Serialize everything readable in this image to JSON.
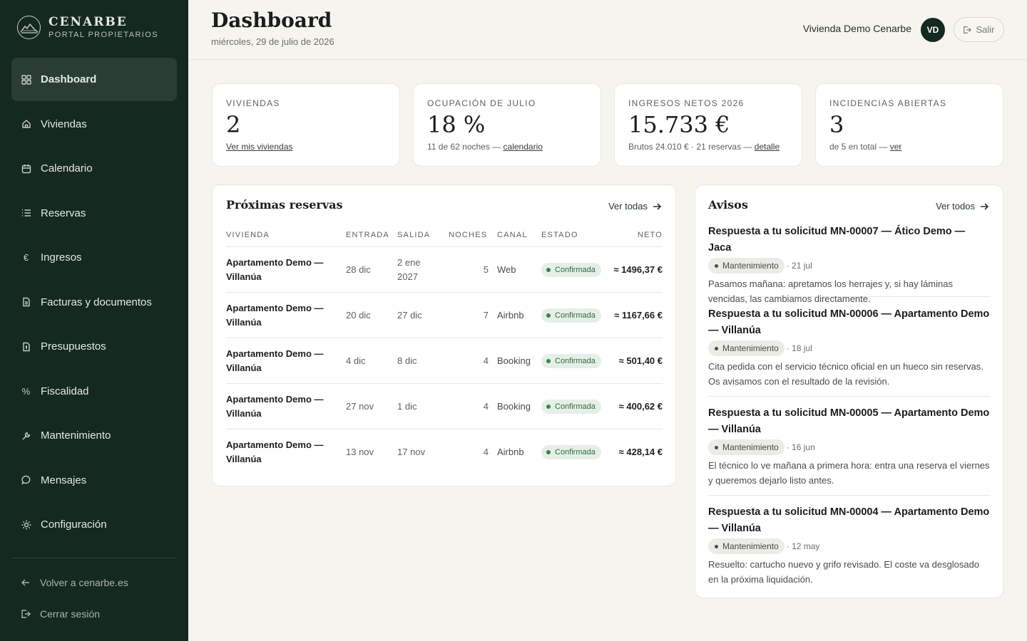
{
  "brand": {
    "name": "CENARBE",
    "subtitle": "PORTAL PROPIETARIOS"
  },
  "nav": [
    {
      "label": "Dashboard",
      "icon": "grid-icon",
      "active": true
    },
    {
      "label": "Viviendas",
      "icon": "home-icon"
    },
    {
      "label": "Calendario",
      "icon": "calendar-icon"
    },
    {
      "label": "Reservas",
      "icon": "list-icon"
    },
    {
      "label": "Ingresos",
      "icon": "euro-icon"
    },
    {
      "label": "Facturas y documentos",
      "icon": "document-icon"
    },
    {
      "label": "Presupuestos",
      "icon": "quote-document-icon"
    },
    {
      "label": "Fiscalidad",
      "icon": "percent-icon"
    },
    {
      "label": "Mantenimiento",
      "icon": "wrench-icon"
    },
    {
      "label": "Mensajes",
      "icon": "chat-icon"
    },
    {
      "label": "Configuración",
      "icon": "sun-gear-icon"
    }
  ],
  "footer": {
    "back_label": "Volver a cenarbe.es",
    "logout_label": "Cerrar sesión"
  },
  "header": {
    "title": "Dashboard",
    "date": "miércoles, 29 de julio de 2026",
    "user_name": "Vivienda Demo Cenarbe",
    "avatar_initials": "VD",
    "logout_label": "Salir"
  },
  "stats": [
    {
      "label": "VIVIENDAS",
      "value": "2",
      "sub_text": "",
      "link": "Ver mis viviendas"
    },
    {
      "label": "OCUPACIÓN DE JULIO",
      "value": "18 %",
      "sub_text": "11 de 62 noches — ",
      "link": "calendario"
    },
    {
      "label": "INGRESOS NETOS 2026",
      "value": "15.733 €",
      "sub_text": "Brutos 24.010 € · 21 reservas — ",
      "link": "detalle"
    },
    {
      "label": "INCIDENCIAS ABIERTAS",
      "value": "3",
      "sub_text": "de 5 en total — ",
      "link": "ver"
    }
  ],
  "reservations": {
    "title": "Próximas reservas",
    "link": "Ver todas",
    "columns": {
      "vivienda": "VIVIENDA",
      "entrada": "ENTRADA",
      "salida": "SALIDA",
      "noches": "NOCHES",
      "canal": "CANAL",
      "estado": "ESTADO",
      "neto": "NETO"
    },
    "rows": [
      {
        "vivienda": "Apartamento Demo — Villanúa",
        "entrada": "28 dic",
        "salida": "2 ene 2027",
        "noches": "5",
        "canal": "Web",
        "estado": "Confirmada",
        "neto": "≈ 1496,37 €"
      },
      {
        "vivienda": "Apartamento Demo — Villanúa",
        "entrada": "20 dic",
        "salida": "27 dic",
        "noches": "7",
        "canal": "Airbnb",
        "estado": "Confirmada",
        "neto": "≈ 1167,66 €"
      },
      {
        "vivienda": "Apartamento Demo — Villanúa",
        "entrada": "4 dic",
        "salida": "8 dic",
        "noches": "4",
        "canal": "Booking",
        "estado": "Confirmada",
        "neto": "≈ 501,40 €"
      },
      {
        "vivienda": "Apartamento Demo — Villanúa",
        "entrada": "27 nov",
        "salida": "1 dic",
        "noches": "4",
        "canal": "Booking",
        "estado": "Confirmada",
        "neto": "≈ 400,62 €"
      },
      {
        "vivienda": "Apartamento Demo — Villanúa",
        "entrada": "13 nov",
        "salida": "17 nov",
        "noches": "4",
        "canal": "Airbnb",
        "estado": "Confirmada",
        "neto": "≈ 428,14 €"
      }
    ]
  },
  "notices": {
    "title": "Avisos",
    "link": "Ver todos",
    "items": [
      {
        "title": "Respuesta a tu solicitud MN-00007 — Ático Demo — Jaca",
        "tag": "Mantenimiento",
        "date": "· 21 jul",
        "body": "Pasamos mañana: apretamos los herrajes y, si hay láminas vencidas, las cambiamos directamente."
      },
      {
        "title": "Respuesta a tu solicitud MN-00006 — Apartamento Demo — Villanúa",
        "tag": "Mantenimiento",
        "date": "· 18 jul",
        "body": "Cita pedida con el servicio técnico oficial en un hueco sin reservas. Os avisamos con el resultado de la revisión."
      },
      {
        "title": "Respuesta a tu solicitud MN-00005 — Apartamento Demo — Villanúa",
        "tag": "Mantenimiento",
        "date": "· 16 jun",
        "body": "El técnico lo ve mañana a primera hora: entra una reserva el viernes y queremos dejarlo listo antes."
      },
      {
        "title": "Respuesta a tu solicitud MN-00004 — Apartamento Demo — Villanúa",
        "tag": "Mantenimiento",
        "date": "· 12 may",
        "body": "Resuelto: cartucho nuevo y grifo revisado. El coste va desglosado en la próxima liquidación."
      }
    ]
  }
}
